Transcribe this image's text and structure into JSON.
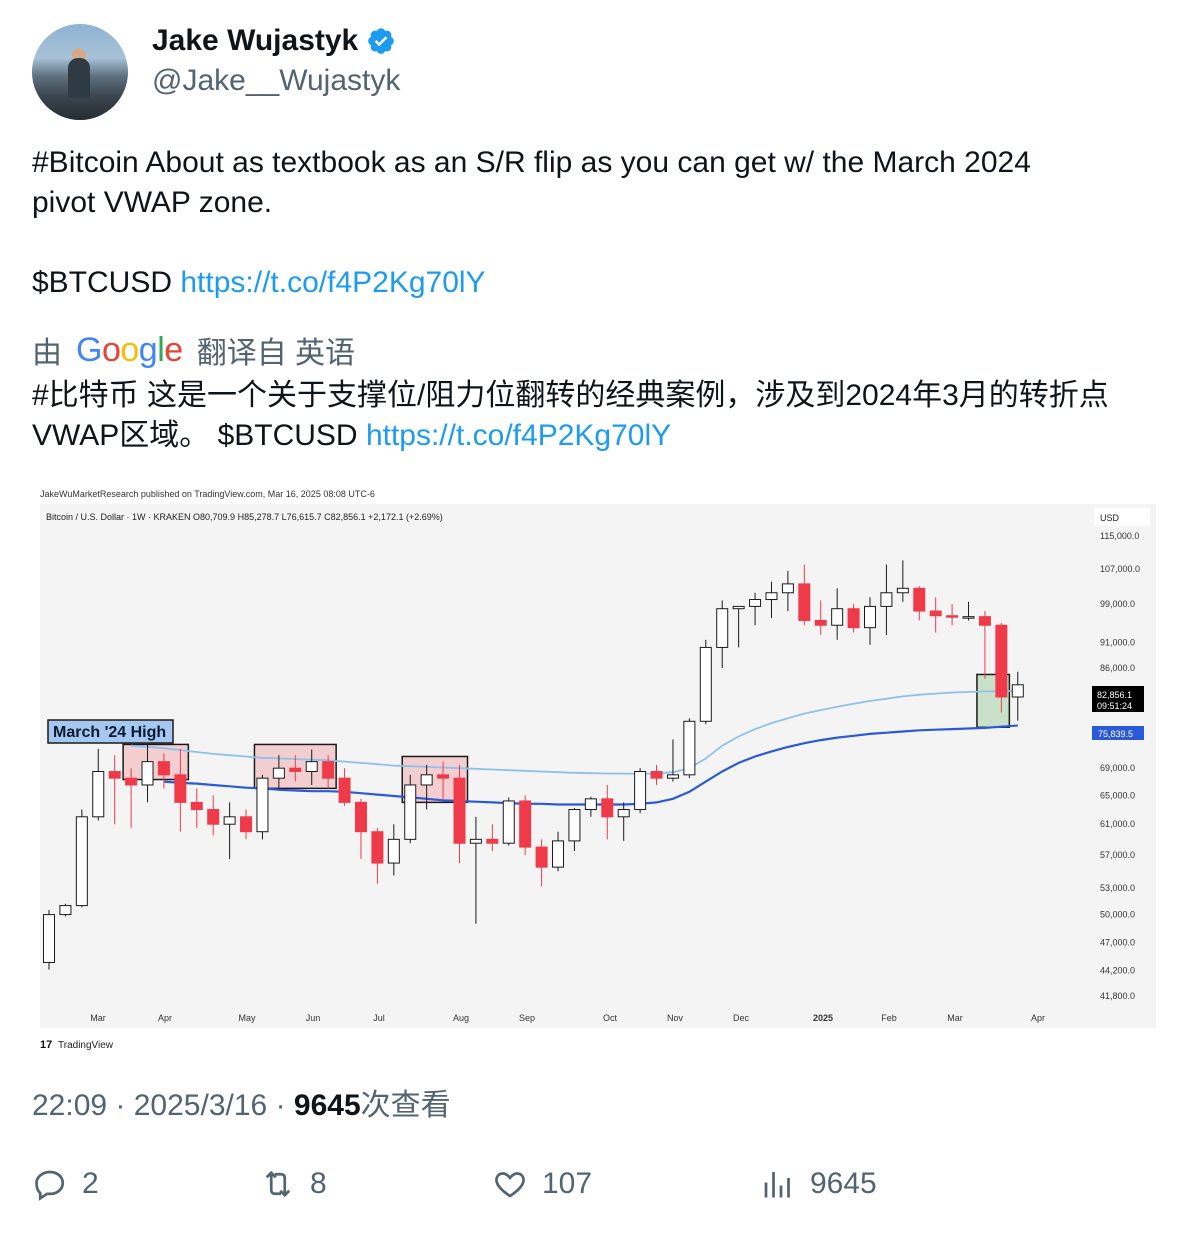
{
  "author": {
    "name": "Jake Wujastyk",
    "handle": "@Jake__Wujastyk"
  },
  "tweet": {
    "text_line1": "#Bitcoin About as textbook as an S/R flip as you can get w/ the March 2024",
    "text_line2": "pivot VWAP zone.",
    "ticker": "$BTCUSD",
    "link": "https://t.co/f4P2Kg70lY"
  },
  "translation": {
    "prefix": "由",
    "provider": "Google",
    "suffix": "翻译自 英语",
    "text": "#比特币 这是一个关于支撑位/阻力位翻转的经典案例，涉及到2024年3月的转折点VWAP区域。 $BTCUSD",
    "link": "https://t.co/f4P2Kg70lY"
  },
  "chart_data": {
    "type": "candlestick",
    "published_by": "JakeWuMarketResearch published on TradingView.com, Mar 16, 2025 08:08 UTC-6",
    "symbol_line": "Bitcoin / U.S. Dollar · 1W · KRAKEN  O80,709.9  H85,278.7  L76,615.7  C82,856.1  +2,172.1 (+2.69%)",
    "currency": "USD",
    "y_ticks": [
      "115,000.0",
      "107,000.0",
      "99,000.0",
      "91,000.0",
      "86,000.0",
      "69,000.0",
      "65,000.0",
      "61,000.0",
      "57,000.0",
      "53,000.0",
      "50,000.0",
      "47,000.0",
      "44,200.0",
      "41,800.0"
    ],
    "x_ticks": [
      "Mar",
      "Apr",
      "May",
      "Jun",
      "Jul",
      "Aug",
      "Sep",
      "Oct",
      "Nov",
      "Dec",
      "2025",
      "Feb",
      "Mar",
      "Apr"
    ],
    "annotation": "March '24 High",
    "last_price": "82,856.1",
    "countdown": "09:51:24",
    "vwap_label": "75,839.5",
    "footer": "TradingView",
    "ylim": [
      41800,
      115000
    ],
    "candles": [
      [
        45000,
        50500,
        44300,
        50000
      ],
      [
        50000,
        51200,
        49800,
        51000
      ],
      [
        51000,
        63000,
        50800,
        62000
      ],
      [
        62000,
        72000,
        61500,
        68500
      ],
      [
        68500,
        71000,
        61000,
        67500
      ],
      [
        67500,
        69000,
        60500,
        66500
      ],
      [
        66500,
        72700,
        64000,
        70000
      ],
      [
        70000,
        71300,
        66000,
        68000
      ],
      [
        68000,
        72000,
        60000,
        64000
      ],
      [
        64000,
        66000,
        60500,
        63000
      ],
      [
        63000,
        65000,
        59500,
        61000
      ],
      [
        61000,
        64000,
        56500,
        62000
      ],
      [
        62000,
        63000,
        59000,
        60000
      ],
      [
        60000,
        68000,
        59000,
        67500
      ],
      [
        67500,
        71000,
        66000,
        69000
      ],
      [
        69000,
        71000,
        67000,
        68500
      ],
      [
        68500,
        71900,
        66500,
        70000
      ],
      [
        70000,
        71000,
        66000,
        67500
      ],
      [
        67500,
        69000,
        63500,
        64000
      ],
      [
        64000,
        64500,
        56500,
        60000
      ],
      [
        60000,
        60500,
        53500,
        56000
      ],
      [
        56000,
        61000,
        54500,
        59000
      ],
      [
        59000,
        68000,
        58500,
        66500
      ],
      [
        66500,
        69500,
        63000,
        68000
      ],
      [
        68000,
        70000,
        64500,
        67500
      ],
      [
        67500,
        69500,
        56000,
        58500
      ],
      [
        58500,
        62000,
        49000,
        59000
      ],
      [
        59000,
        61000,
        57500,
        58500
      ],
      [
        58500,
        64700,
        58200,
        64200
      ],
      [
        64200,
        65000,
        57000,
        58000
      ],
      [
        58000,
        59000,
        53200,
        55500
      ],
      [
        55500,
        60000,
        55000,
        58800
      ],
      [
        58800,
        63200,
        57500,
        63000
      ],
      [
        63000,
        64800,
        62000,
        64500
      ],
      [
        64500,
        66500,
        59000,
        62000
      ],
      [
        62000,
        64000,
        58800,
        63000
      ],
      [
        63000,
        69000,
        62500,
        68500
      ],
      [
        68500,
        69500,
        66500,
        67500
      ],
      [
        67500,
        73500,
        67000,
        68000
      ],
      [
        68000,
        77000,
        67500,
        76500
      ],
      [
        76500,
        91500,
        76000,
        90000
      ],
      [
        90000,
        99800,
        86000,
        98000
      ],
      [
        98000,
        98500,
        90000,
        98500
      ],
      [
        98500,
        101500,
        94500,
        100000
      ],
      [
        100000,
        104000,
        96000,
        101500
      ],
      [
        101500,
        106500,
        97500,
        103500
      ],
      [
        103500,
        108000,
        94500,
        95500
      ],
      [
        95500,
        99800,
        92500,
        94500
      ],
      [
        94500,
        102500,
        91500,
        98000
      ],
      [
        98000,
        99000,
        93000,
        94000
      ],
      [
        94000,
        100500,
        90500,
        98500
      ],
      [
        98500,
        108000,
        92500,
        101500
      ],
      [
        101500,
        109000,
        99500,
        102500
      ],
      [
        102500,
        103000,
        95500,
        97500
      ],
      [
        97500,
        100500,
        93000,
        96500
      ],
      [
        96500,
        99000,
        94500,
        96200
      ],
      [
        96200,
        99500,
        95500,
        96300
      ],
      [
        96300,
        97500,
        84000,
        94500
      ],
      [
        94500,
        95000,
        78000,
        80700
      ],
      [
        80700,
        85300,
        76600,
        82900
      ]
    ],
    "vwap_upper": [
      null,
      null,
      null,
      null,
      null,
      72500,
      72300,
      72100,
      71800,
      71500,
      71200,
      71000,
      70800,
      70600,
      70500,
      70400,
      70300,
      70200,
      70000,
      69800,
      69600,
      69400,
      69300,
      69200,
      69100,
      69000,
      68900,
      68800,
      68700,
      68600,
      68500,
      68400,
      68300,
      68250,
      68200,
      68180,
      68160,
      68200,
      68400,
      69000,
      70500,
      72500,
      74000,
      75200,
      76200,
      77000,
      77800,
      78400,
      79000,
      79500,
      80000,
      80400,
      80800,
      81100,
      81300,
      81500,
      81600,
      81700,
      81750,
      81800
    ],
    "vwap_lower": [
      null,
      null,
      null,
      null,
      null,
      null,
      null,
      67000,
      66800,
      66700,
      66500,
      66300,
      66100,
      66000,
      65800,
      65700,
      65600,
      65600,
      65500,
      65300,
      65100,
      64900,
      64700,
      64500,
      64300,
      64200,
      64100,
      64000,
      63900,
      63800,
      63800,
      63700,
      63700,
      63700,
      63700,
      63700,
      63800,
      64000,
      64500,
      65500,
      67000,
      68500,
      69800,
      70800,
      71600,
      72300,
      72900,
      73400,
      73800,
      74100,
      74400,
      74600,
      74800,
      75000,
      75100,
      75200,
      75300,
      75400,
      75600,
      75800
    ]
  },
  "meta": {
    "time": "22:09",
    "date": "2025/3/16",
    "views_count": "9645",
    "views_label": "次查看"
  },
  "actions": {
    "replies": "2",
    "retweets": "8",
    "likes": "107",
    "views": "9645"
  },
  "colors": {
    "link": "#1d9bf0",
    "verified": "#1d9bf0",
    "bear": "#ef3a4a",
    "bull": "#ffffff",
    "vwap_upper": "#8ec0ee",
    "vwap_lower": "#2a5ad7"
  }
}
